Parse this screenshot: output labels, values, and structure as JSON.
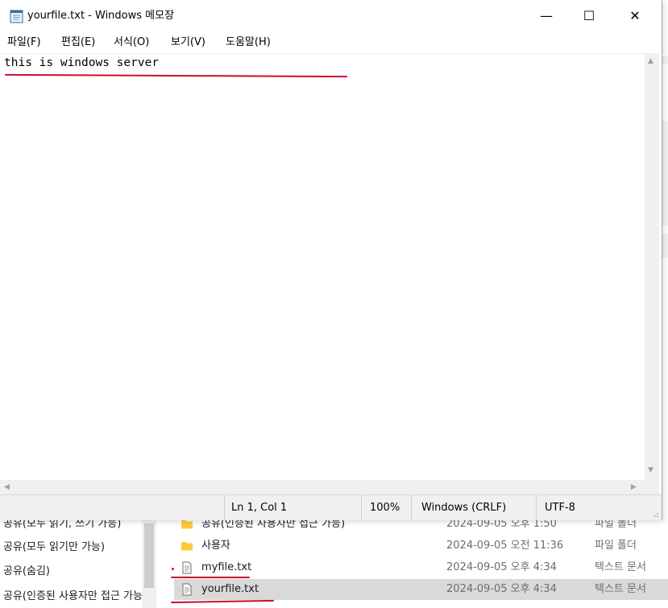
{
  "notepad": {
    "title": "yourfile.txt - Windows 메모장",
    "controls": {
      "minimize": "—",
      "maximize": "☐",
      "close": "✕"
    },
    "menu": [
      "파일(F)",
      "편집(E)",
      "서식(O)",
      "보기(V)",
      "도움말(H)"
    ],
    "content": "this is windows server",
    "status": {
      "position": "Ln 1, Col 1",
      "zoom": "100%",
      "line_ending": "Windows (CRLF)",
      "encoding": "UTF-8"
    }
  },
  "explorer": {
    "nav_items": [
      "공유(모두 읽기, 쓰기 가능)",
      "공유(모두 읽기만 가능)",
      "공유(숨김)",
      "공유(인증된 사용자만 접근 가능)"
    ],
    "files": [
      {
        "name": "공유(인증된 사용자만 접근 가능)",
        "date": "2024-09-05 오후 1:50",
        "type": "파일 폴더",
        "icon": "folder-icon"
      },
      {
        "name": "사용자",
        "date": "2024-09-05 오전 11:36",
        "type": "파일 폴더",
        "icon": "folder-icon"
      },
      {
        "name": "myfile.txt",
        "date": "2024-09-05 오후 4:34",
        "type": "텍스트 문서",
        "icon": "text-file-icon"
      },
      {
        "name": "yourfile.txt",
        "date": "2024-09-05 오후 4:34",
        "type": "텍스트 문서",
        "icon": "text-file-icon"
      }
    ]
  },
  "colors": {
    "annotation": "#c8102e",
    "folder": "#ffc83d",
    "selection": "#d9d9d9"
  }
}
